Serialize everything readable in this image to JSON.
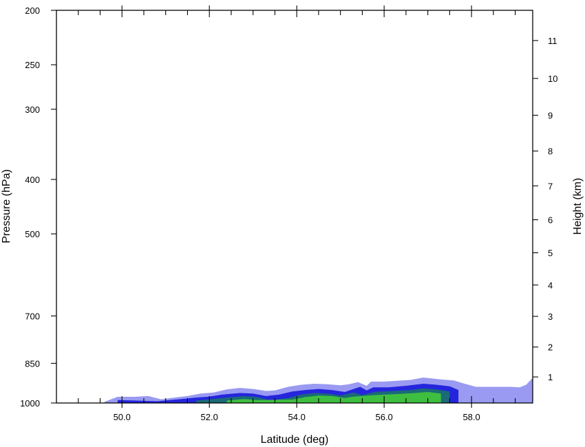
{
  "chart_data": {
    "type": "heatmap",
    "title": "",
    "xlabel": "Latitude (deg)",
    "ylabel": "Pressure (hPa)",
    "ylabel_right": "Height (km)",
    "xlim": [
      48.5,
      59.4
    ],
    "ylim": [
      1000,
      200
    ],
    "x_ticks": [
      {
        "value": 50,
        "label": "50.0"
      },
      {
        "value": 52,
        "label": "52.0"
      },
      {
        "value": 54,
        "label": "54.0"
      },
      {
        "value": 56,
        "label": "56.0"
      },
      {
        "value": 58,
        "label": "58.0"
      }
    ],
    "y_ticks": [
      {
        "value": 200,
        "label": "200"
      },
      {
        "value": 250,
        "label": "250"
      },
      {
        "value": 300,
        "label": "300"
      },
      {
        "value": 400,
        "label": "400"
      },
      {
        "value": 500,
        "label": "500"
      },
      {
        "value": 700,
        "label": "700"
      },
      {
        "value": 850,
        "label": "850"
      },
      {
        "value": 1000,
        "label": "1000"
      }
    ],
    "right_ticks": [
      {
        "value": 1,
        "label": "1"
      },
      {
        "value": 2,
        "label": "2"
      },
      {
        "value": 3,
        "label": "3"
      },
      {
        "value": 4,
        "label": "4"
      },
      {
        "value": 5,
        "label": "5"
      },
      {
        "value": 6,
        "label": "6"
      },
      {
        "value": 7,
        "label": "7"
      },
      {
        "value": 8,
        "label": "8"
      },
      {
        "value": 9,
        "label": "9"
      },
      {
        "value": 10,
        "label": "10"
      },
      {
        "value": 11,
        "label": "11"
      }
    ],
    "fill_colors": [
      "#9a9af2",
      "#2525dd",
      "#1a6a78",
      "#3fbf3f"
    ],
    "layers": [
      {
        "level": 1,
        "color": "#9a9af2",
        "top": [
          [
            49.6,
            995
          ],
          [
            49.9,
            975
          ],
          [
            50.3,
            975
          ],
          [
            50.6,
            972
          ],
          [
            50.9,
            985
          ],
          [
            51.2,
            978
          ],
          [
            51.5,
            972
          ],
          [
            51.8,
            962
          ],
          [
            52.1,
            958
          ],
          [
            52.4,
            946
          ],
          [
            52.7,
            940
          ],
          [
            53.0,
            944
          ],
          [
            53.3,
            952
          ],
          [
            53.5,
            950
          ],
          [
            53.8,
            936
          ],
          [
            54.1,
            928
          ],
          [
            54.4,
            924
          ],
          [
            54.7,
            926
          ],
          [
            55.0,
            930
          ],
          [
            55.2,
            926
          ],
          [
            55.4,
            918
          ],
          [
            55.6,
            932
          ],
          [
            55.7,
            916
          ],
          [
            56.0,
            916
          ],
          [
            56.4,
            912
          ],
          [
            56.6,
            910
          ],
          [
            56.9,
            901
          ],
          [
            57.3,
            908
          ],
          [
            57.6,
            912
          ],
          [
            57.8,
            922
          ],
          [
            58.1,
            936
          ],
          [
            58.5,
            936
          ],
          [
            58.9,
            936
          ],
          [
            59.1,
            938
          ],
          [
            59.25,
            928
          ],
          [
            59.4,
            902
          ]
        ],
        "base": 1000
      },
      {
        "level": 2,
        "color": "#2525dd",
        "top": [
          [
            49.9,
            988
          ],
          [
            50.3,
            990
          ],
          [
            50.8,
            993
          ],
          [
            51.3,
            985
          ],
          [
            51.7,
            978
          ],
          [
            52.0,
            974
          ],
          [
            52.3,
            966
          ],
          [
            52.7,
            960
          ],
          [
            53.0,
            962
          ],
          [
            53.3,
            972
          ],
          [
            53.6,
            966
          ],
          [
            53.9,
            954
          ],
          [
            54.2,
            948
          ],
          [
            54.5,
            944
          ],
          [
            54.8,
            948
          ],
          [
            55.1,
            956
          ],
          [
            55.3,
            944
          ],
          [
            55.45,
            936
          ],
          [
            55.6,
            950
          ],
          [
            55.75,
            938
          ],
          [
            56.1,
            938
          ],
          [
            56.5,
            932
          ],
          [
            56.9,
            924
          ],
          [
            57.2,
            928
          ],
          [
            57.5,
            934
          ],
          [
            57.7,
            948
          ]
        ],
        "base": 1000
      },
      {
        "level": 3,
        "color": "#1a6a78",
        "top": [
          [
            51.7,
            990
          ],
          [
            52.0,
            985
          ],
          [
            52.4,
            978
          ],
          [
            52.8,
            972
          ],
          [
            53.1,
            976
          ],
          [
            53.4,
            990
          ],
          [
            53.8,
            980
          ],
          [
            54.1,
            966
          ],
          [
            54.4,
            960
          ],
          [
            54.7,
            962
          ],
          [
            55.0,
            970
          ],
          [
            55.3,
            958
          ],
          [
            55.5,
            968
          ],
          [
            55.8,
            955
          ],
          [
            56.2,
            952
          ],
          [
            56.6,
            948
          ],
          [
            56.9,
            942
          ],
          [
            57.2,
            946
          ],
          [
            57.5,
            954
          ]
        ],
        "base": 1000
      },
      {
        "level": 4,
        "color": "#3fbf3f",
        "top": [
          [
            52.4,
            990
          ],
          [
            52.8,
            984
          ],
          [
            53.1,
            988
          ],
          [
            53.9,
            986
          ],
          [
            54.2,
            976
          ],
          [
            54.5,
            970
          ],
          [
            54.8,
            972
          ],
          [
            55.1,
            980
          ],
          [
            55.3,
            974
          ],
          [
            55.8,
            968
          ],
          [
            56.3,
            964
          ],
          [
            56.7,
            960
          ],
          [
            57.0,
            956
          ],
          [
            57.3,
            962
          ]
        ],
        "base": 1000
      }
    ]
  }
}
